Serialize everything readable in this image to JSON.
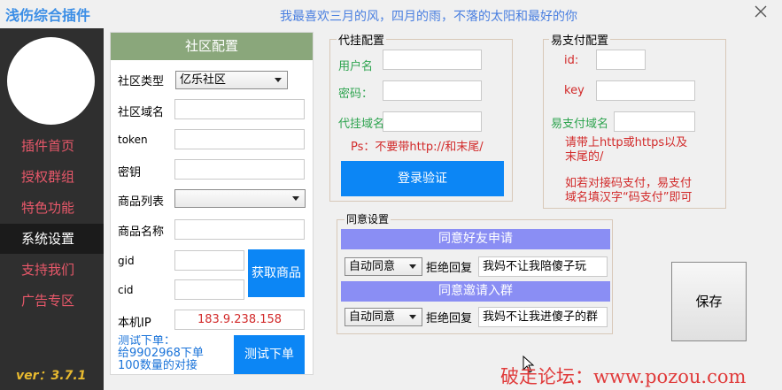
{
  "window": {
    "title": "浅伤综合插件",
    "motto": "我最喜欢三月的风，四月的雨，不落的太阳和最好的你"
  },
  "sidebar": {
    "items": [
      {
        "label": "插件首页"
      },
      {
        "label": "授权群组"
      },
      {
        "label": "特色功能"
      },
      {
        "label": "系统设置"
      },
      {
        "label": "支持我们"
      },
      {
        "label": "广告专区"
      }
    ],
    "active": "系统设置",
    "version": "ver：3.7.1"
  },
  "community": {
    "header": "社区配置",
    "type_label": "社区类型",
    "type_value": "亿乐社区",
    "domain_label": "社区域名",
    "token_label": "token",
    "secret_label": "密钥",
    "goods_list_label": "商品列表",
    "goods_name_label": "商品名称",
    "gid_label": "gid",
    "cid_label": "cid",
    "get_goods_button": "获取商品",
    "ip_label": "本机IP",
    "ip_value": "183.9.238.158",
    "test_note": "测试下单：\n给9902968下单\n100数量的对接",
    "test_button": "测试下单"
  },
  "proxy": {
    "title": "代挂配置",
    "user_label": "用户名",
    "password_label": "密码：",
    "domain_label": "代挂域名",
    "note": "Ps：不要带http://和末尾/",
    "login_button": "登录验证"
  },
  "epay": {
    "title": "易支付配置",
    "id_label": "id:",
    "key_label": "key",
    "domain_label": "易支付域名",
    "note1": "请带上http或https以及\n末尾的/",
    "note2": "如若对接码支付，易支付\n域名填汉字“码支付”即可"
  },
  "consent": {
    "title": "同意设置",
    "friend_header": "同意好友申请",
    "friend_select": "自动同意",
    "friend_reject_label": "拒绝回复",
    "friend_reply": "我妈不让我陪傻子玩",
    "group_header": "同意邀请入群",
    "group_select": "自动同意",
    "group_reject_label": "拒绝回复",
    "group_reply": "我妈不让我进傻子的群"
  },
  "save_button": "保存",
  "watermark": "破走论坛：www.pozou.com",
  "colors": {
    "sidebar_bg": "#2f2f2f",
    "nav_text": "#e8586a",
    "accent_blue": "#0c86f5",
    "header_green": "#8aa77b",
    "purple_bar": "#8a8ef4",
    "label_green": "#2ea44f",
    "note_red": "#d22a2a",
    "version_gold": "#e8ba2f"
  }
}
